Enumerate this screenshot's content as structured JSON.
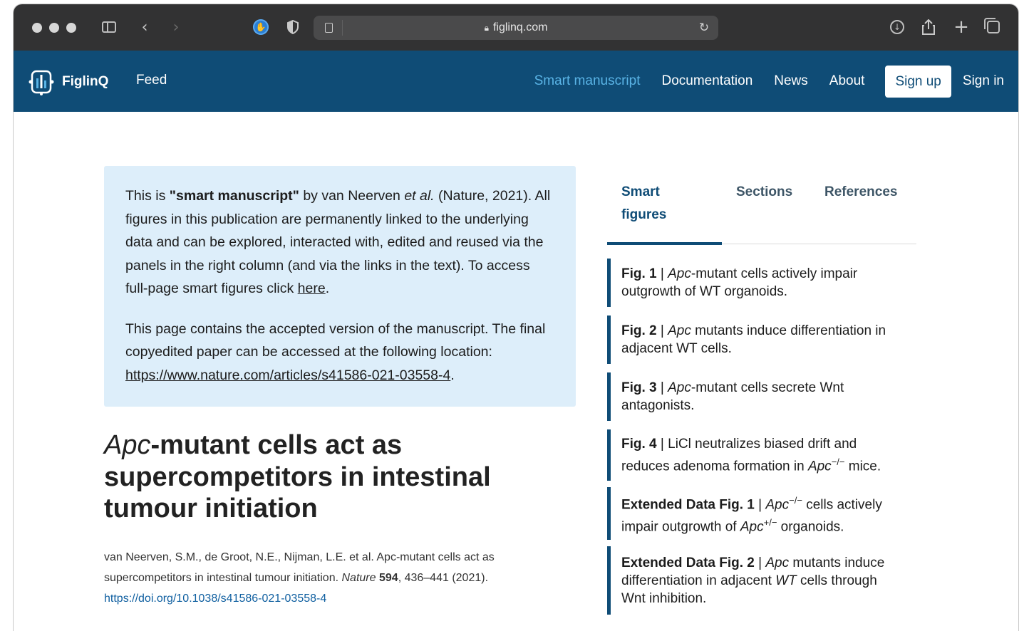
{
  "browser": {
    "url": "figlinq.com",
    "colors": {
      "chrome": "#323233",
      "address_bar": "#4a4a4b"
    }
  },
  "nav": {
    "brand": "FiglinQ",
    "feed": "Feed",
    "links": [
      "Smart manuscript",
      "Documentation",
      "News",
      "About"
    ],
    "signup": "Sign up",
    "signin": "Sign in",
    "colors": {
      "bar": "#0f4c76",
      "active_link": "#5ab4e6"
    }
  },
  "callout": {
    "p1_prefix": "This is ",
    "p1_bold": "\"smart manuscript\"",
    "p1_by": " by van Neerven ",
    "p1_etal": "et al.",
    "p1_rest": " (Nature, 2021). All figures in this publication are permanently linked to the underlying data and can be explored, interacted with, edited and reused via the panels in the right column (and via the links in the text). To access full-page smart figures click ",
    "p1_link": "here",
    "p1_end": ".",
    "p2_text": "This page contains the accepted version of the manuscript. The final copyedited paper can be accessed at the following location: ",
    "p2_link": "https://www.nature.com/articles/s41586-021-03558-4",
    "p2_end": ".",
    "color": "#ddeefa"
  },
  "article": {
    "title_italic": "Apc",
    "title_rest": "-mutant cells act as supercompetitors in intestinal tumour initiation",
    "citation_text": "van Neerven, S.M., de Groot, N.E., Nijman, L.E. et al. Apc-mutant cells act as supercompetitors in intestinal tumour initiation. ",
    "citation_journal": "Nature",
    "citation_volume": "594",
    "citation_pages": ", 436–441 (2021).",
    "doi": "https://doi.org/10.1038/s41586-021-03558-4"
  },
  "panel": {
    "tabs": [
      "Smart figures",
      "Sections",
      "References"
    ],
    "figures": [
      {
        "label": "Fig. 1",
        "parts": [
          [
            "i",
            "Apc"
          ],
          [
            "t",
            "-mutant cells actively impair outgrowth of WT organoids."
          ]
        ]
      },
      {
        "label": "Fig. 2",
        "parts": [
          [
            "i",
            "Apc"
          ],
          [
            "t",
            " mutants induce differentiation in adjacent WT cells."
          ]
        ]
      },
      {
        "label": "Fig. 3",
        "parts": [
          [
            "i",
            "Apc"
          ],
          [
            "t",
            "-mutant cells secrete Wnt antagonists."
          ]
        ]
      },
      {
        "label": "Fig. 4",
        "parts": [
          [
            "t",
            "LiCl neutralizes biased drift and reduces adenoma formation in "
          ],
          [
            "i",
            "Apc"
          ],
          [
            "sup",
            "−/−"
          ],
          [
            "t",
            " mice."
          ]
        ]
      },
      {
        "label": "Extended Data Fig. 1",
        "parts": [
          [
            "i",
            "Apc"
          ],
          [
            "sup",
            "−/−"
          ],
          [
            "t",
            " cells actively impair outgrowth of "
          ],
          [
            "i",
            "Apc"
          ],
          [
            "sup",
            "+/−"
          ],
          [
            "t",
            " organoids."
          ]
        ]
      },
      {
        "label": "Extended Data Fig. 2",
        "parts": [
          [
            "i",
            "Apc"
          ],
          [
            "t",
            " mutants induce differentiation in adjacent "
          ],
          [
            "i",
            "WT"
          ],
          [
            "t",
            " cells through Wnt inhibition."
          ]
        ]
      }
    ]
  }
}
